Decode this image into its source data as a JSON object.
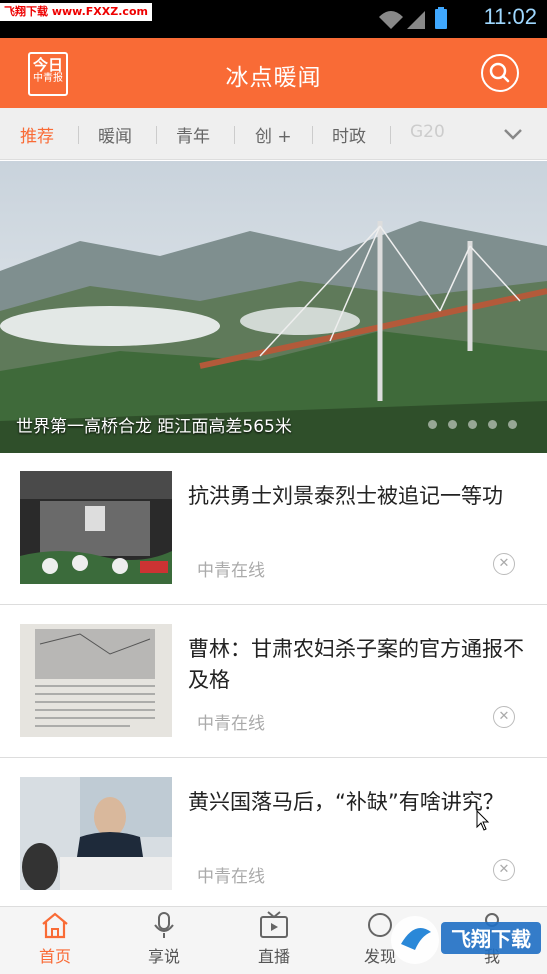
{
  "status_bar": {
    "watermark": "飞翔下载 www.FXXZ.com",
    "time": "11:02"
  },
  "header": {
    "logo_line1": "今日",
    "logo_line2": "中青报",
    "title": "冰点暖闻"
  },
  "tabs": [
    {
      "label": "推荐"
    },
    {
      "label": "暖闻"
    },
    {
      "label": "青年"
    },
    {
      "label": "创 +"
    },
    {
      "label": "时政"
    },
    {
      "label": "G20"
    }
  ],
  "banner": {
    "caption": "世界第一高桥合龙 距江面高差565米",
    "slide_count": 5
  },
  "news": [
    {
      "title": "抗洪勇士刘景泰烈士被追记一等功",
      "source": "中青在线"
    },
    {
      "title": "曹林：甘肃农妇杀子案的官方通报不及格",
      "source": "中青在线"
    },
    {
      "title": "黄兴国落马后，“补缺”有啥讲究？",
      "source": "中青在线"
    }
  ],
  "bottom_nav": [
    {
      "label": "首页",
      "icon": "home-icon"
    },
    {
      "label": "享说",
      "icon": "microphone-icon"
    },
    {
      "label": "直播",
      "icon": "tv-icon"
    },
    {
      "label": "发现",
      "icon": "discover-icon"
    },
    {
      "label": "我",
      "icon": "user-icon"
    }
  ],
  "watermark_bottom": "飞翔下载",
  "colors": {
    "accent": "#f96b36"
  }
}
